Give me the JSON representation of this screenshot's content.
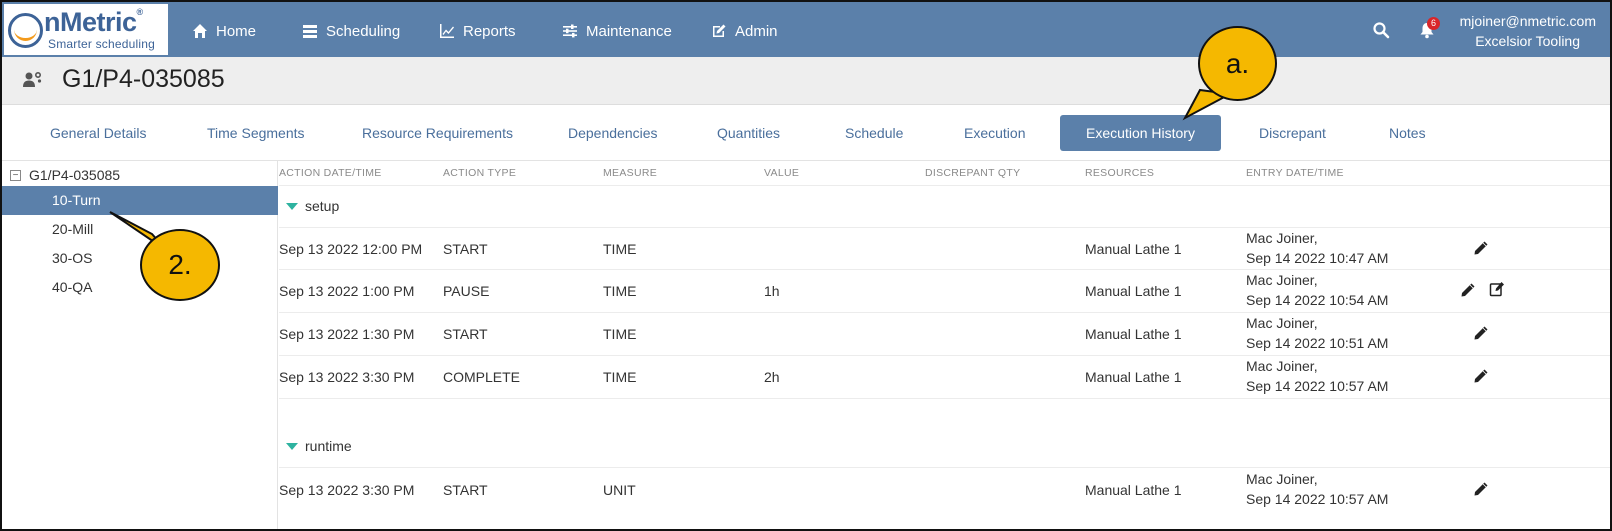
{
  "logo": {
    "word": "nMetric",
    "reg": "®",
    "tagline": "Smarter scheduling"
  },
  "nav": [
    {
      "label": "Home",
      "icon": "home-icon"
    },
    {
      "label": "Scheduling",
      "icon": "list-icon"
    },
    {
      "label": "Reports",
      "icon": "chart-icon"
    },
    {
      "label": "Maintenance",
      "icon": "sliders-icon"
    },
    {
      "label": "Admin",
      "icon": "edit-icon"
    }
  ],
  "header": {
    "notification_count": "6",
    "user_email": "mjoiner@nmetric.com",
    "company": "Excelsior Tooling"
  },
  "page": {
    "title": "G1/P4-035085"
  },
  "tabs": [
    "General Details",
    "Time Segments",
    "Resource Requirements",
    "Dependencies",
    "Quantities",
    "Schedule",
    "Execution",
    "Execution History",
    "Discrepant",
    "Notes"
  ],
  "active_tab": "Execution History",
  "tree": {
    "root": "G1/P4-035085",
    "toggle": "−",
    "items": [
      "10-Turn",
      "20-Mill",
      "30-OS",
      "40-QA"
    ],
    "selected": "10-Turn"
  },
  "table": {
    "headers": [
      "Action Date/Time",
      "Action Type",
      "Measure",
      "Value",
      "Discrepant Qty",
      "Resources",
      "Entry Date/Time"
    ],
    "groups": [
      {
        "name": "setup",
        "rows": [
          {
            "action_datetime": "Sep 13 2022 12:00 PM",
            "action_type": "START",
            "measure": "TIME",
            "value": "",
            "discrepant_qty": "",
            "resources": "Manual Lathe 1",
            "entry_user": "Mac Joiner,",
            "entry_datetime": "Sep 14 2022 10:47 AM"
          },
          {
            "action_datetime": "Sep 13 2022 1:00 PM",
            "action_type": "PAUSE",
            "measure": "TIME",
            "value": "1h",
            "discrepant_qty": "",
            "resources": "Manual Lathe 1",
            "entry_user": "Mac Joiner,",
            "entry_datetime": "Sep 14 2022 10:54 AM"
          },
          {
            "action_datetime": "Sep 13 2022 1:30 PM",
            "action_type": "START",
            "measure": "TIME",
            "value": "",
            "discrepant_qty": "",
            "resources": "Manual Lathe 1",
            "entry_user": "Mac Joiner,",
            "entry_datetime": "Sep 14 2022 10:51 AM"
          },
          {
            "action_datetime": "Sep 13 2022 3:30 PM",
            "action_type": "COMPLETE",
            "measure": "TIME",
            "value": "2h",
            "discrepant_qty": "",
            "resources": "Manual Lathe 1",
            "entry_user": "Mac Joiner,",
            "entry_datetime": "Sep 14 2022 10:57 AM"
          }
        ]
      },
      {
        "name": "runtime",
        "rows": [
          {
            "action_datetime": "Sep 13 2022 3:30 PM",
            "action_type": "START",
            "measure": "UNIT",
            "value": "",
            "discrepant_qty": "",
            "resources": "Manual Lathe 1",
            "entry_user": "Mac Joiner,",
            "entry_datetime": "Sep 14 2022 10:57 AM"
          }
        ]
      }
    ]
  },
  "annotations": [
    {
      "label": "a.",
      "target": "Execution History tab"
    },
    {
      "label": "2.",
      "target": "10-Turn tree item"
    }
  ],
  "colors": {
    "nav_bg": "#5b80aa",
    "accent": "#5b80aa",
    "callout": "#f5b800",
    "caret": "#2eb3a0",
    "badge": "#d9262a"
  }
}
